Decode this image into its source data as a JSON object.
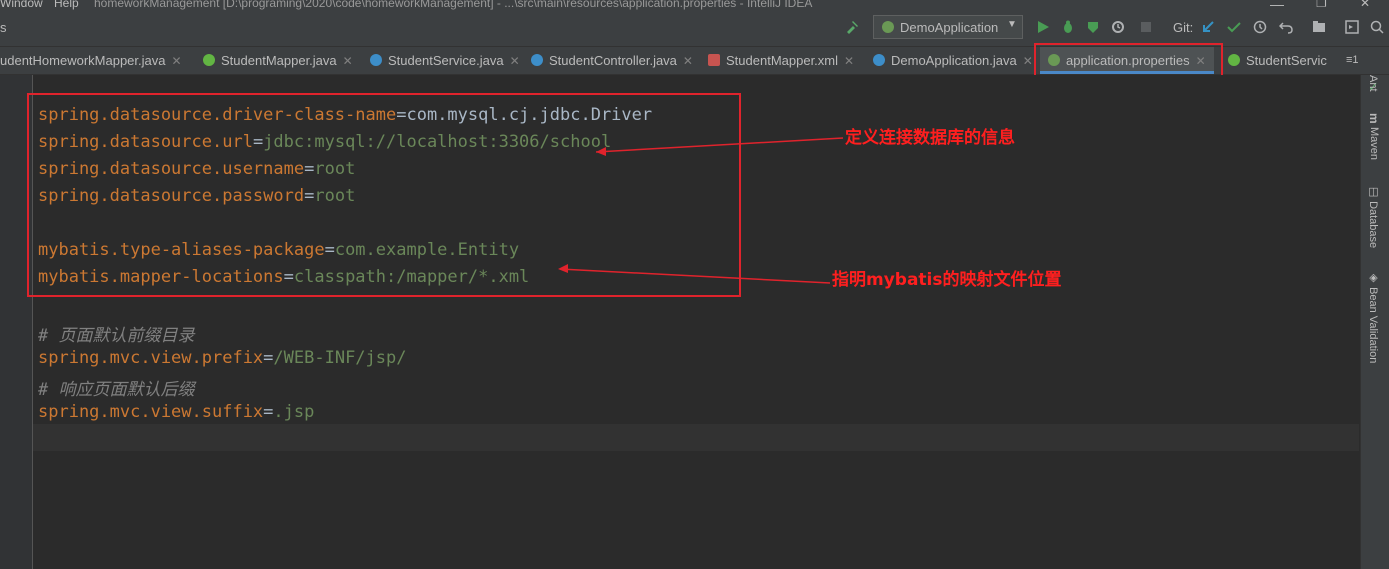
{
  "titlebar": {
    "menu_window": "Window",
    "menu_help": "Help",
    "title": "homeworkManagement [D:\\programing\\2020\\code\\homeworkManagement] - ...\\src\\main\\resources\\application.properties - IntelliJ IDEA"
  },
  "toolbar": {
    "left_fragment": "s",
    "run_config": "DemoApplication",
    "git_label": "Git:"
  },
  "tabs": [
    {
      "label": "udentHomeworkMapper.java",
      "icon": "interface-icon"
    },
    {
      "label": "StudentMapper.java",
      "icon": "interface-icon"
    },
    {
      "label": "StudentService.java",
      "icon": "class-icon"
    },
    {
      "label": "StudentController.java",
      "icon": "class-icon"
    },
    {
      "label": "StudentMapper.xml",
      "icon": "xml-icon"
    },
    {
      "label": "DemoApplication.java",
      "icon": "spring-class-icon"
    },
    {
      "label": "application.properties",
      "icon": "spring-properties-icon",
      "active": true
    },
    {
      "label": "StudentServic",
      "icon": "interface-icon"
    }
  ],
  "tab_overflow": "≡1",
  "code": [
    {
      "key": "spring.datasource.driver-class-name",
      "value": "com.mysql.cj.jdbc.Driver"
    },
    {
      "key": "spring.datasource.url",
      "value": "jdbc:mysql://localhost:3306/school"
    },
    {
      "key": "spring.datasource.username",
      "value": "root"
    },
    {
      "key": "spring.datasource.password",
      "value": "root"
    },
    {
      "key": "mybatis.type-aliases-package",
      "value": "com.example.Entity"
    },
    {
      "key": "mybatis.mapper-locations",
      "value": "classpath:/mapper/*.xml"
    },
    {
      "comment": "# 页面默认前缀目录"
    },
    {
      "key": "spring.mvc.view.prefix",
      "value": "/WEB-INF/jsp/"
    },
    {
      "comment": "# 响应页面默认后缀"
    },
    {
      "key": "spring.mvc.view.suffix",
      "value": ".jsp"
    }
  ],
  "annotations": {
    "db_info": "定义连接数据库的信息",
    "mybatis_mapping": "指明mybatis的映射文件位置"
  },
  "right_sidebar": {
    "ant": "Ant",
    "maven": "Maven",
    "database": "Database",
    "bean_validation": "Bean Validation"
  },
  "colors": {
    "background": "#2b2b2b",
    "key": "#cc7832",
    "value": "#6a8759",
    "comment": "#808080",
    "annotation": "#ff1f1f"
  }
}
